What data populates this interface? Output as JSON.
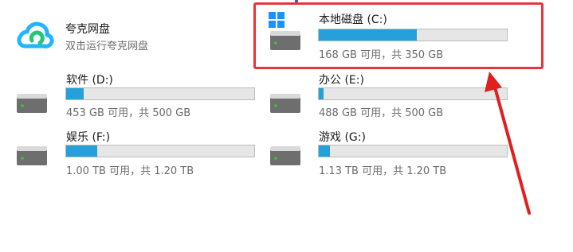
{
  "colors": {
    "bar_fill": "#26a0da",
    "bar_track": "#e6e6e6",
    "highlight": "#e8343a",
    "arrow": "#e11f1f"
  },
  "quark": {
    "name": "夸克网盘",
    "subtitle": "双击运行夸克网盘",
    "icon": "cloud-icon"
  },
  "drives": [
    {
      "label": "本地磁盘 (C:)",
      "space": "168 GB 可用，共 350 GB",
      "used_fraction": 0.52,
      "system": true
    },
    {
      "label": "软件 (D:)",
      "space": "453 GB 可用，共 500 GB",
      "used_fraction": 0.094
    },
    {
      "label": "办公 (E:)",
      "space": "488 GB 可用，共 500 GB",
      "used_fraction": 0.024
    },
    {
      "label": "娱乐 (F:)",
      "space": "1.00 TB 可用，共 1.20 TB",
      "used_fraction": 0.167
    },
    {
      "label": "游戏 (G:)",
      "space": "1.13 TB 可用，共 1.20 TB",
      "used_fraction": 0.058
    }
  ]
}
